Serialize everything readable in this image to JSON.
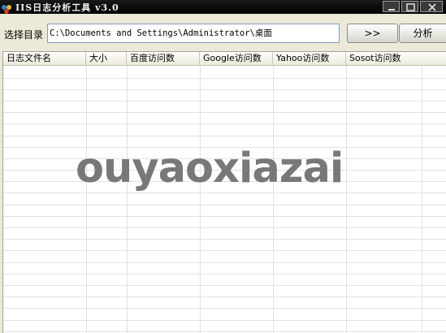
{
  "window": {
    "title": "IIS日志分析工具 v3.0"
  },
  "toolbar": {
    "dir_label": "选择目录",
    "path_value": "C:\\Documents and Settings\\Administrator\\桌面",
    "browse_label": ">>",
    "analyze_label": "分析"
  },
  "grid": {
    "columns": [
      "日志文件名",
      "大小",
      "百度访问数",
      "Google访问数",
      "Yahoo访问数",
      "Sosot访问数"
    ],
    "rows": []
  },
  "watermark": "ouyaoxiazai",
  "icons": {
    "app": "app-icon",
    "minimize": "minimize-icon",
    "maximize": "maximize-icon",
    "close": "close-icon"
  }
}
